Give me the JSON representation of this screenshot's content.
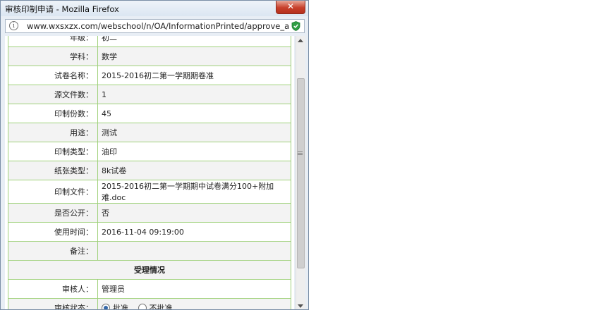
{
  "window": {
    "title": "审核印制申请 - Mozilla Firefox",
    "close_label": "✕",
    "url": "www.wxsxzx.com/webschool/n/OA/InformationPrinted/approve_apply_prin"
  },
  "rows": [
    {
      "label": "年级：",
      "value": "初二"
    },
    {
      "label": "学科：",
      "value": "数学"
    },
    {
      "label": "试卷名称：",
      "value": "2015-2016初二第一学期期卷准"
    },
    {
      "label": "源文件数：",
      "value": "1"
    },
    {
      "label": "印制份数：",
      "value": "45"
    },
    {
      "label": "用途：",
      "value": "测试"
    },
    {
      "label": "印制类型：",
      "value": "油印"
    },
    {
      "label": "纸张类型：",
      "value": "8k试卷"
    },
    {
      "label": "印制文件：",
      "value": "2015-2016初二第一学期期中试卷满分100+附加难.doc"
    },
    {
      "label": "是否公开：",
      "value": "否"
    },
    {
      "label": "使用时间：",
      "value": "2016-11-04 09:19:00"
    },
    {
      "label": "备注：",
      "value": ""
    }
  ],
  "section_title": "受理情况",
  "reviewer": {
    "label": "审核人：",
    "value": "管理员"
  },
  "status": {
    "label": "审核状态：",
    "option_approve": "批准",
    "option_reject": "不批准",
    "selected": "批准"
  }
}
